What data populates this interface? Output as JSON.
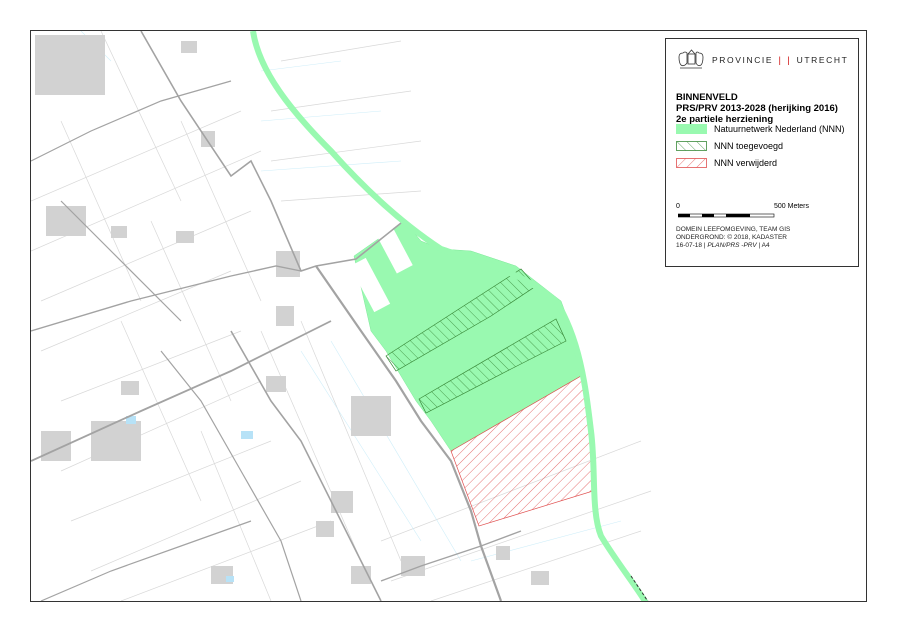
{
  "map": {
    "colors": {
      "nnn_fill": "#99f9b0",
      "nnn_border": "#5fd98a",
      "added_hatch": "#3a8a3a",
      "removed_hatch": "#e05050",
      "road": "#a3a3a3",
      "parcel_line": "#d6d6d6",
      "building": "#d2d2d2",
      "water": "#b7e2f7"
    }
  },
  "legend": {
    "logo_left": "PROVINCIE",
    "logo_separator": "❘❘",
    "logo_right": "UTRECHT",
    "title_line1": "BINNENVELD",
    "title_line2": "PRS/PRV 2013-2028 (herijking 2016)",
    "title_line3": "2e partiele herziening",
    "items": [
      {
        "label": "Natuurnetwerk Nederland (NNN)",
        "type": "fill",
        "color": "#99f9b0"
      },
      {
        "label": "NNN toegevoegd",
        "type": "hatch",
        "color": "#3a8a3a"
      },
      {
        "label": "NNN verwijderd",
        "type": "hatch",
        "color": "#e05050"
      }
    ],
    "scale_start": "0",
    "scale_end": "500 Meters",
    "credit_line1": "DOMEIN LEEFOMGEVING, TEAM GIS",
    "credit_line2": "ONDERGROND: © 2018, KADASTER",
    "credit_date": "16-07-18",
    "credit_file": "PLAN/PRS -PRV",
    "credit_format": "A4"
  }
}
